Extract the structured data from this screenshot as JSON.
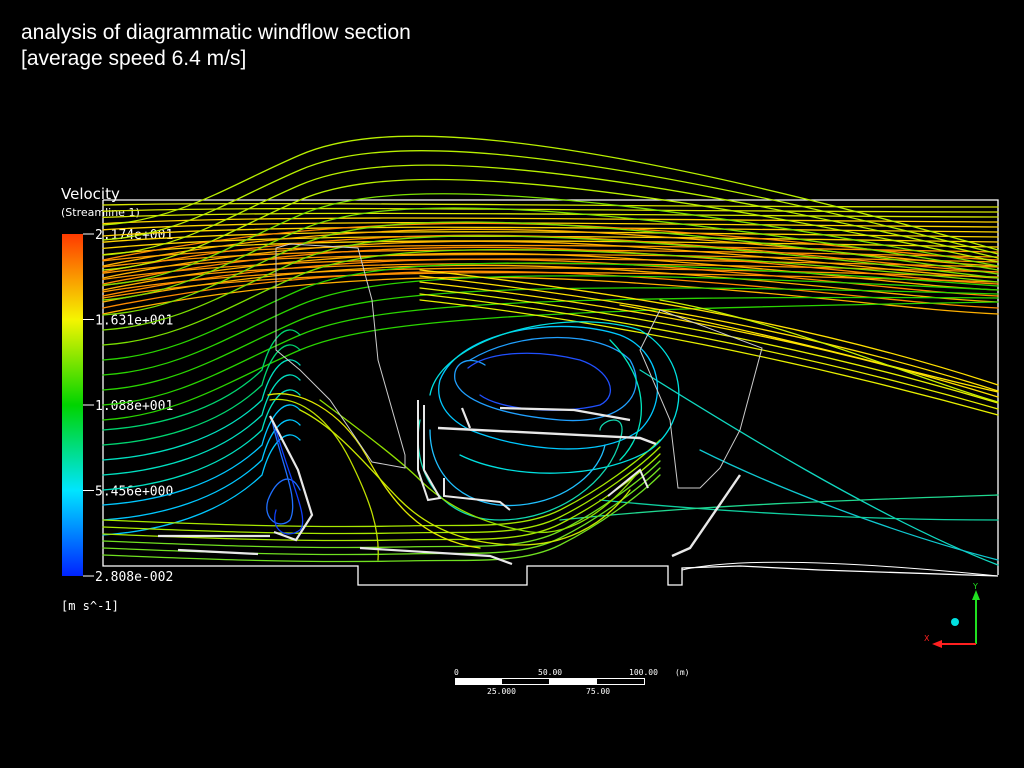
{
  "title": {
    "line1": "analysis of diagrammatic windflow section",
    "line2": "[average speed 6.4 m/s]"
  },
  "legend": {
    "heading": "Velocity",
    "subheading": "(Streamline 1)",
    "unit": "[m s^-1]",
    "tick_labels": [
      "2.174e+001",
      "1.631e+001",
      "1.088e+001",
      "5.456e+000",
      "2.808e-002"
    ],
    "colors": [
      "#ff3a00",
      "#f5f500",
      "#00d400",
      "#00e5ff",
      "#0022ff"
    ]
  },
  "scale_bar": {
    "top_labels": [
      "0",
      "50.00",
      "100.00"
    ],
    "unit": "(m)",
    "bottom_labels": [
      "25.000",
      "75.00"
    ]
  },
  "axis_triad": {
    "x_label": "X",
    "y_label": "Y",
    "x_color": "#ff2020",
    "y_color": "#20e020",
    "dot_color": "#00e0e0"
  }
}
